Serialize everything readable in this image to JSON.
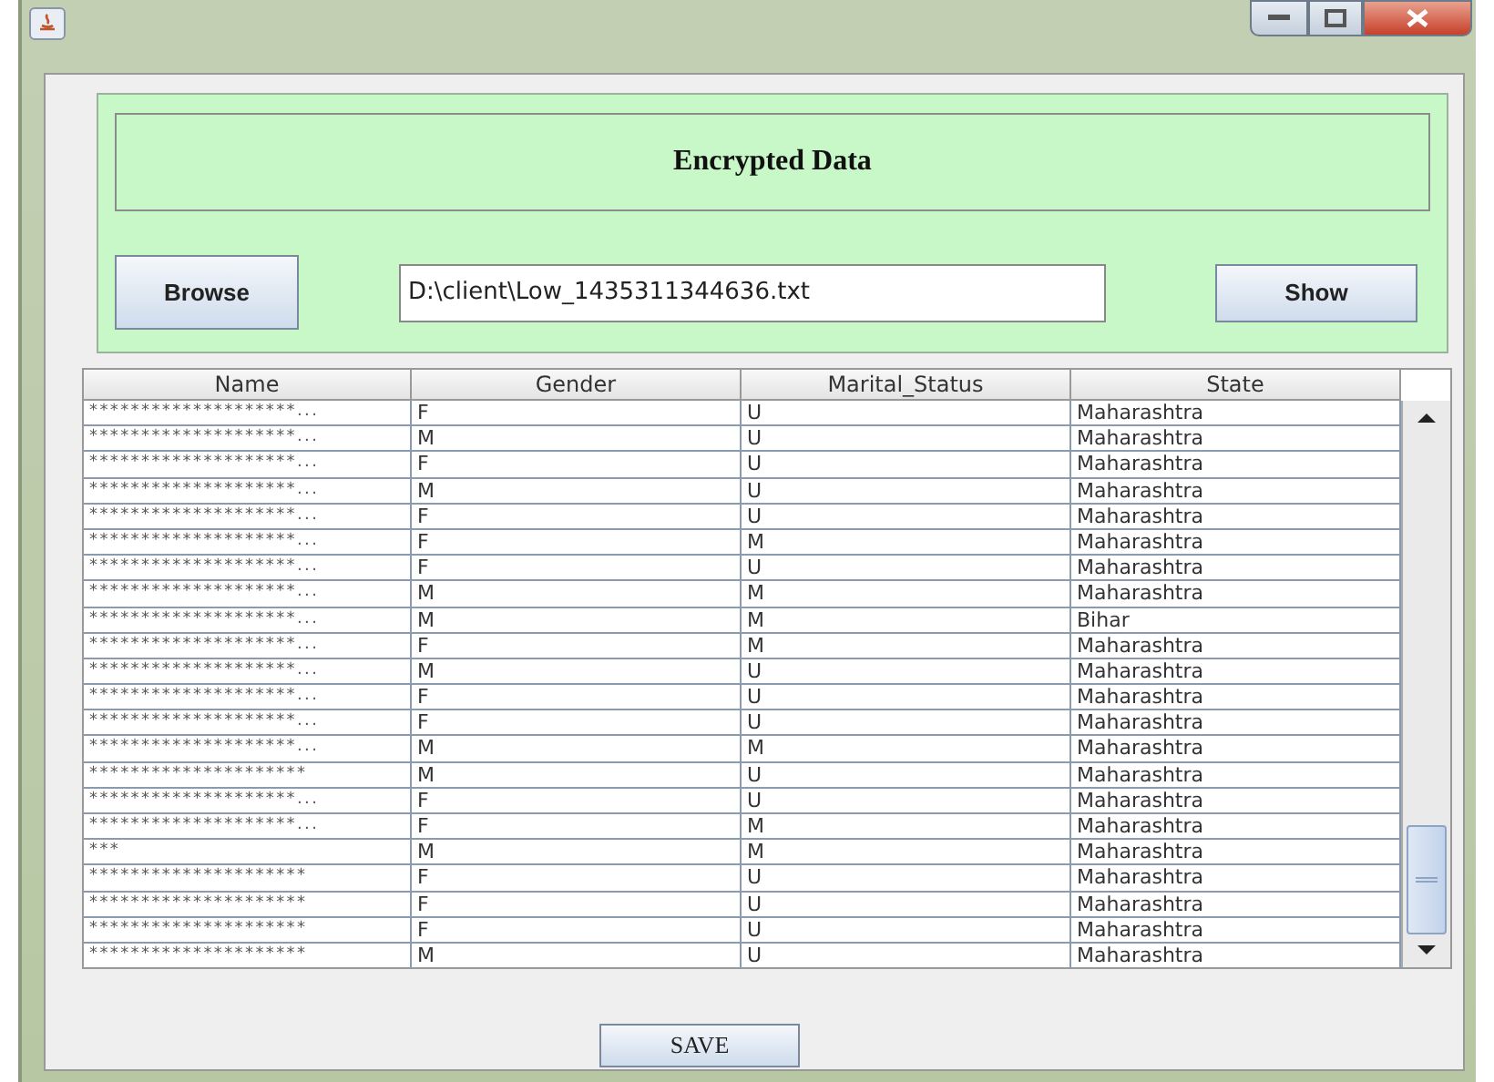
{
  "header": {
    "title": "Encrypted Data"
  },
  "controls": {
    "browse_button": "Browse",
    "file_path": "D:\\client\\Low_1435311344636.txt",
    "show_button": "Show"
  },
  "table": {
    "columns": [
      "Name",
      "Gender",
      "Marital_Status",
      "State"
    ],
    "rows": [
      [
        "********************...",
        "F",
        "U",
        "Maharashtra"
      ],
      [
        "********************...",
        "M",
        "U",
        "Maharashtra"
      ],
      [
        "********************...",
        "F",
        "U",
        "Maharashtra"
      ],
      [
        "********************...",
        "M",
        "U",
        "Maharashtra"
      ],
      [
        "********************...",
        "F",
        "U",
        "Maharashtra"
      ],
      [
        "********************...",
        "F",
        "M",
        "Maharashtra"
      ],
      [
        "********************...",
        "F",
        "U",
        "Maharashtra"
      ],
      [
        "********************...",
        "M",
        "M",
        "Maharashtra"
      ],
      [
        "********************...",
        "M",
        "M",
        "Bihar"
      ],
      [
        "********************...",
        "F",
        "M",
        "Maharashtra"
      ],
      [
        "********************...",
        "M",
        "U",
        "Maharashtra"
      ],
      [
        "********************...",
        "F",
        "U",
        "Maharashtra"
      ],
      [
        "********************...",
        "F",
        "U",
        "Maharashtra"
      ],
      [
        "********************...",
        "M",
        "M",
        "Maharashtra"
      ],
      [
        "*********************",
        "M",
        "U",
        "Maharashtra"
      ],
      [
        "********************...",
        "F",
        "U",
        "Maharashtra"
      ],
      [
        "********************...",
        "F",
        "M",
        "Maharashtra"
      ],
      [
        "***",
        "M",
        "M",
        "Maharashtra"
      ],
      [
        "*********************",
        "F",
        "U",
        "Maharashtra"
      ],
      [
        "*********************",
        "F",
        "U",
        "Maharashtra"
      ],
      [
        "*********************",
        "F",
        "U",
        "Maharashtra"
      ],
      [
        "*********************",
        "M",
        "U",
        "Maharashtra"
      ]
    ]
  },
  "save_button": "SAVE"
}
